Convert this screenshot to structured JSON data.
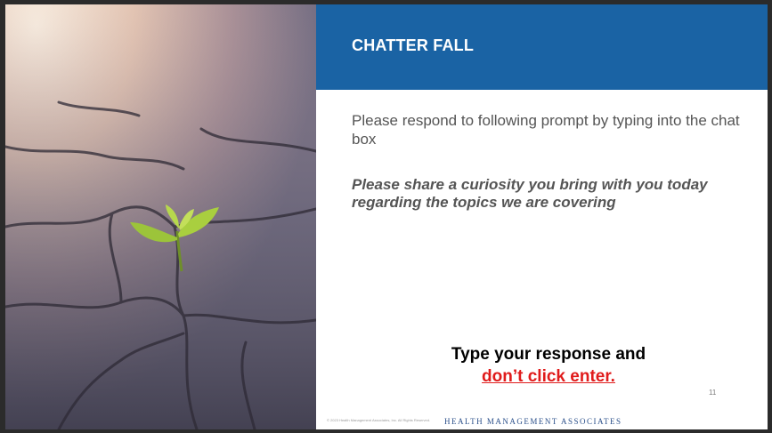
{
  "slide": {
    "title": "CHATTER FALL",
    "prompt": "Please respond to following prompt by typing into the chat box",
    "question": "Please share a curiosity you bring with you today regarding the topics we are covering",
    "instruction_line1": "Type your response and",
    "instruction_line2": "don’t click enter.",
    "copyright": "© 2023 Health Management Associates, Inc. All Rights Reserved.",
    "logo": "Health Management Associates",
    "page_number": "11"
  },
  "colors": {
    "title_band": "#1a63a4",
    "warning": "#e01b1b",
    "body_text": "#555555"
  }
}
